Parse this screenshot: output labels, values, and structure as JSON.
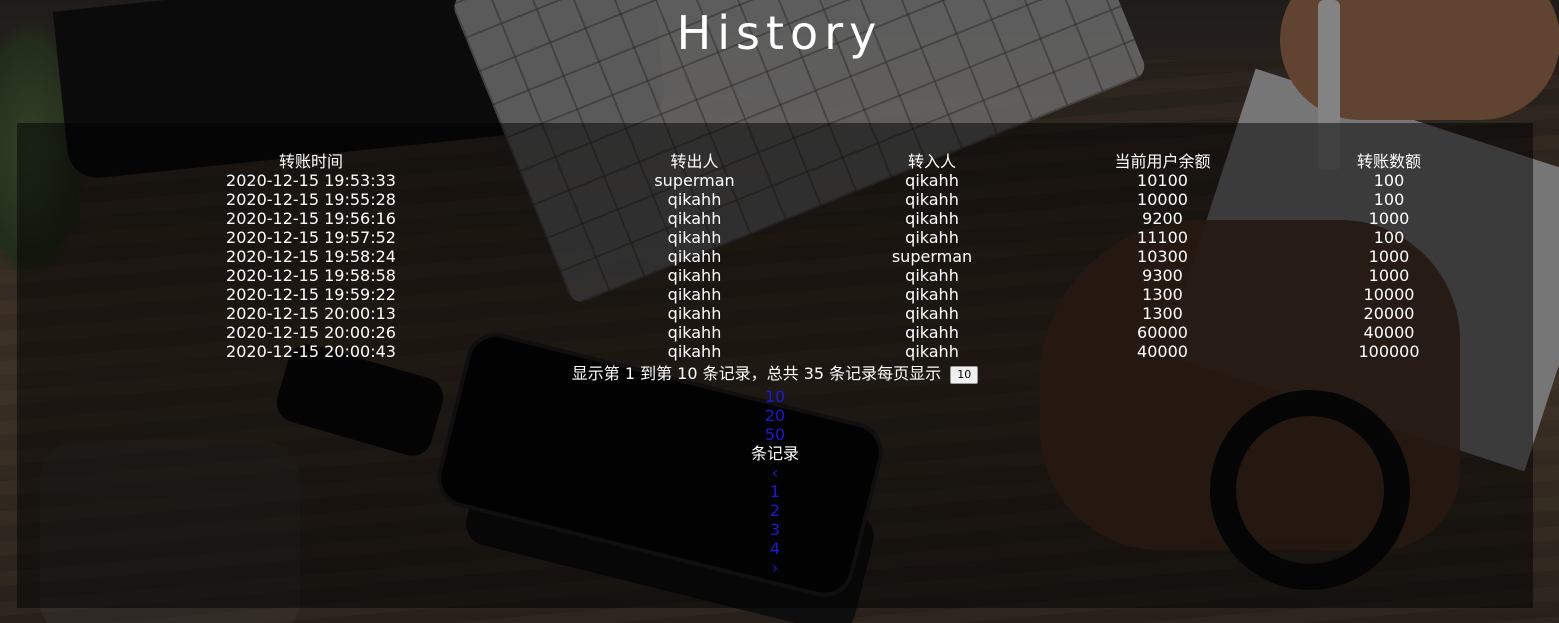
{
  "page": {
    "title": "History"
  },
  "table": {
    "columns": [
      "转账时间",
      "转出人",
      "转入人",
      "当前用户余额",
      "转账数额"
    ],
    "rows": [
      [
        "2020-12-15 19:53:33",
        "superman",
        "qikahh",
        "10100",
        "100"
      ],
      [
        "2020-12-15 19:55:28",
        "qikahh",
        "qikahh",
        "10000",
        "100"
      ],
      [
        "2020-12-15 19:56:16",
        "qikahh",
        "qikahh",
        "9200",
        "1000"
      ],
      [
        "2020-12-15 19:57:52",
        "qikahh",
        "qikahh",
        "11100",
        "100"
      ],
      [
        "2020-12-15 19:58:24",
        "qikahh",
        "superman",
        "10300",
        "1000"
      ],
      [
        "2020-12-15 19:58:58",
        "qikahh",
        "qikahh",
        "9300",
        "1000"
      ],
      [
        "2020-12-15 19:59:22",
        "qikahh",
        "qikahh",
        "1300",
        "10000"
      ],
      [
        "2020-12-15 20:00:13",
        "qikahh",
        "qikahh",
        "1300",
        "20000"
      ],
      [
        "2020-12-15 20:00:26",
        "qikahh",
        "qikahh",
        "60000",
        "40000"
      ],
      [
        "2020-12-15 20:00:43",
        "qikahh",
        "qikahh",
        "40000",
        "100000"
      ]
    ]
  },
  "pagination": {
    "info_text": "显示第 1 到第 10 条记录，总共 35 条记录每页显示",
    "page_size_selected": "10",
    "page_size_options": [
      "10",
      "20",
      "50"
    ],
    "page_size_suffix": "条记录",
    "prev_label": "‹",
    "pages": [
      "1",
      "2",
      "3",
      "4"
    ],
    "next_label": "›"
  }
}
